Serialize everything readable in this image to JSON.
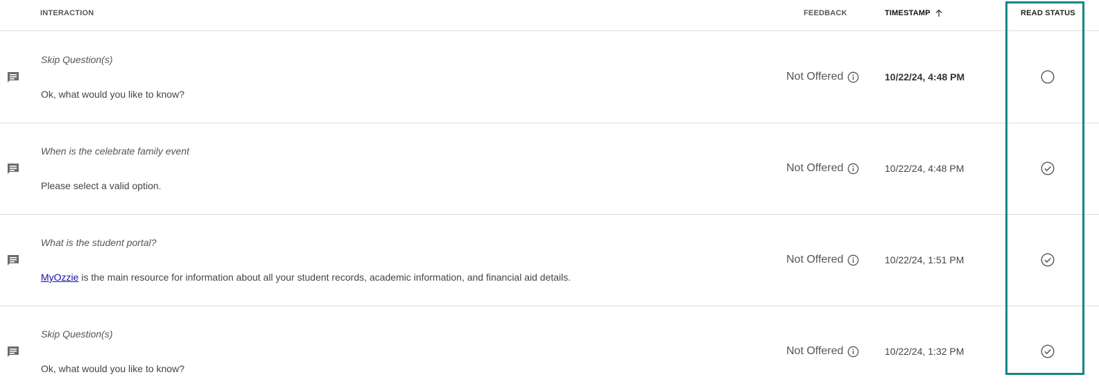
{
  "header": {
    "interaction": "INTERACTION",
    "feedback": "FEEDBACK",
    "timestamp": "TIMESTAMP",
    "read_status": "READ STATUS"
  },
  "rows": [
    {
      "question": "Skip Question(s)",
      "answer": "Ok, what would you like to know?",
      "feedback": "Not Offered",
      "timestamp": "10/22/24, 4:48 PM",
      "read": false,
      "unread_bold": true
    },
    {
      "question": "When is the celebrate family event",
      "answer": "Please select a valid option.",
      "feedback": "Not Offered",
      "timestamp": "10/22/24, 4:48 PM",
      "read": true
    },
    {
      "question": "What is the student portal?",
      "answer_link": "MyOzzie",
      "answer": " is the main resource for information about all your student records, academic information, and financial aid details.",
      "feedback": "Not Offered",
      "timestamp": "10/22/24, 1:51 PM",
      "read": true
    },
    {
      "question": "Skip Question(s)",
      "answer": "Ok, what would you like to know?",
      "feedback": "Not Offered",
      "timestamp": "10/22/24, 1:32 PM",
      "read": true
    }
  ],
  "colors": {
    "highlight": "#0f8584",
    "link": "#1a0dab",
    "icon": "#6b6b6b"
  },
  "icons": {
    "row": "chat-message-icon",
    "sort": "arrow-up-icon",
    "info": "info-icon",
    "unread": "empty-circle-icon",
    "read": "check-circle-icon"
  }
}
